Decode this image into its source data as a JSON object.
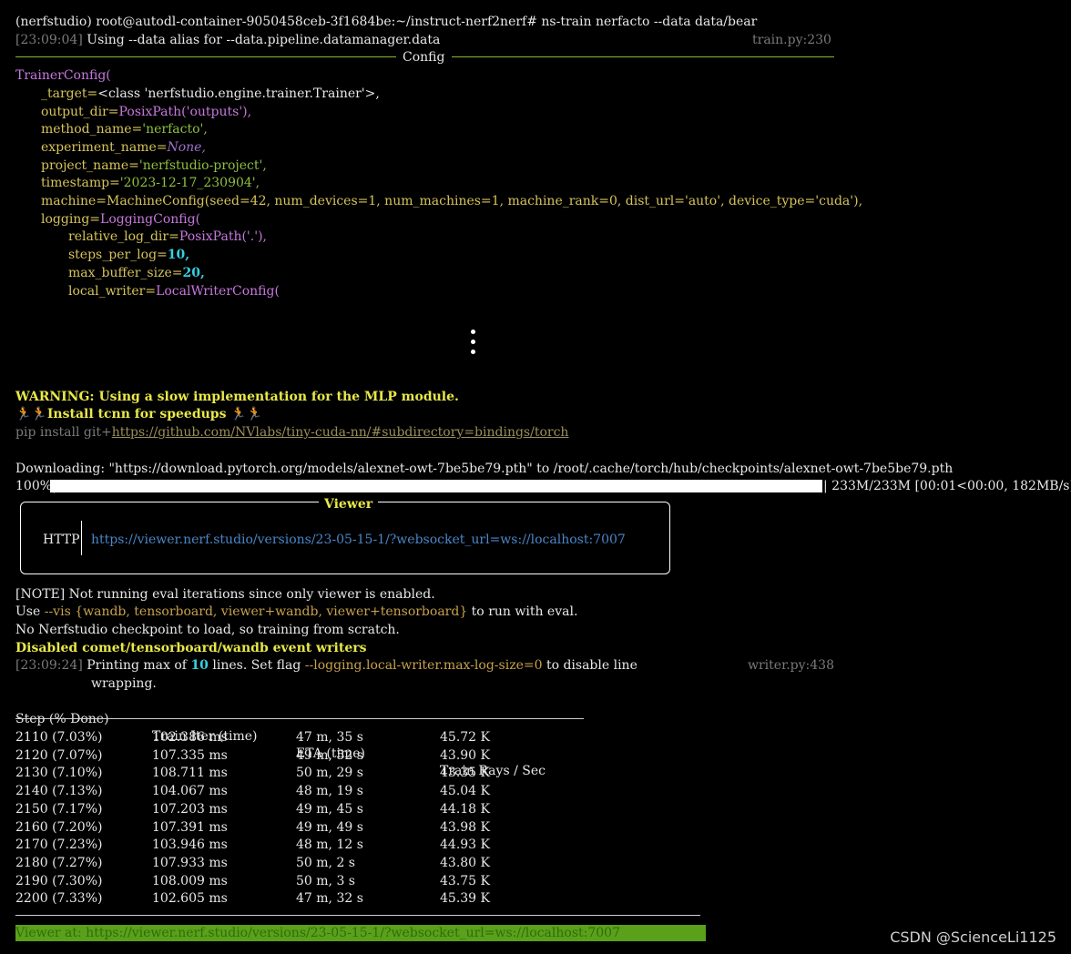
{
  "prompt": "(nerfstudio) root@autodl-container-9050458ceb-3f1684be:~/instruct-nerf2nerf# ns-train nerfacto --data data/bear",
  "log1": {
    "time": "[23:09:04]",
    "text": "Using --data alias for --data.pipeline.datamanager.data",
    "src": "train.py:230"
  },
  "config_title": "Config",
  "config": {
    "l1": "TrainerConfig(",
    "target_k": "_target=",
    "target_v": "<class 'nerfstudio.engine.trainer.Trainer'>,",
    "outdir_k": "output_dir=",
    "outdir_v": "PosixPath('outputs'),",
    "method_k": "method_name=",
    "method_v": "'nerfacto',",
    "exp_k": "experiment_name=",
    "exp_v": "None,",
    "proj_k": "project_name=",
    "proj_v": "'nerfstudio-project',",
    "ts_k": "timestamp=",
    "ts_v": "'2023-12-17_230904',",
    "machine": "machine=MachineConfig(seed=42, num_devices=1, num_machines=1, machine_rank=0, dist_url='auto', device_type='cuda'),",
    "logging_k": "logging=",
    "logging_v": "LoggingConfig(",
    "rel_k": "relative_log_dir=",
    "rel_v": "PosixPath('.'),",
    "steps_k": "steps_per_log=",
    "steps_v": "10,",
    "buf_k": "max_buffer_size=",
    "buf_v": "20,",
    "lw_k": "local_writer=",
    "lw_v": "LocalWriterConfig("
  },
  "warning": {
    "l1": "WARNING: Using a slow implementation for the MLP module.",
    "l2": "🏃🏃Install tcnn for speedups 🏃🏃",
    "l3a": "pip install git+",
    "l3b": "https://github.com/NVlabs/tiny-cuda-nn/#subdirectory=bindings/torch"
  },
  "download": {
    "line": "Downloading: \"https://download.pytorch.org/models/alexnet-owt-7be5be79.pth\" to /root/.cache/torch/hub/checkpoints/alexnet-owt-7be5be79.pth",
    "percent": "100%|",
    "progress": 1.0,
    "stats": "| 233M/233M [00:01<00:00, 182MB/s]"
  },
  "viewer": {
    "title": "Viewer",
    "proto": "HTTP",
    "url": "https://viewer.nerf.studio/versions/23-05-15-1/?websocket_url=ws://localhost:7007"
  },
  "notes": {
    "n1": "[NOTE] Not running eval iterations since only viewer is enabled.",
    "n2a": "Use ",
    "n2b": "--vis {wandb, tensorboard, viewer+wandb, viewer+tensorboard}",
    "n2c": " to run with eval.",
    "n3": "No Nerfstudio checkpoint to load, so training from scratch.",
    "n4": "Disabled comet/tensorboard/wandb event writers"
  },
  "log2": {
    "time": "[23:09:24]",
    "t1": "Printing max of ",
    "t2": "10",
    "t3": " lines. Set flag ",
    "t4": "--logging.local-writer.max-log-size=0",
    "t5": " to disable line",
    "t6": "wrapping.",
    "src": "writer.py:438"
  },
  "table": {
    "headers": [
      "Step (% Done)",
      "Train Iter (time)",
      "ETA (time)",
      "Train Rays / Sec"
    ],
    "rows": [
      [
        "2110 (7.03%)",
        "102.386 ms",
        "47 m, 35 s",
        "45.72 K"
      ],
      [
        "2120 (7.07%)",
        "107.335 ms",
        "49 m, 52 s",
        "43.90 K"
      ],
      [
        "2130 (7.10%)",
        "108.711 ms",
        "50 m, 29 s",
        "43.35 K"
      ],
      [
        "2140 (7.13%)",
        "104.067 ms",
        "48 m, 19 s",
        "45.04 K"
      ],
      [
        "2150 (7.17%)",
        "107.203 ms",
        "49 m, 45 s",
        "44.18 K"
      ],
      [
        "2160 (7.20%)",
        "107.391 ms",
        "49 m, 49 s",
        "43.98 K"
      ],
      [
        "2170 (7.23%)",
        "103.946 ms",
        "48 m, 12 s",
        "44.93 K"
      ],
      [
        "2180 (7.27%)",
        "107.933 ms",
        "50 m, 2 s",
        "43.80 K"
      ],
      [
        "2190 (7.30%)",
        "108.009 ms",
        "50 m, 3 s",
        "43.75 K"
      ],
      [
        "2200 (7.33%)",
        "102.605 ms",
        "47 m, 32 s",
        "45.39 K"
      ]
    ]
  },
  "footer": "Viewer at: https://viewer.nerf.studio/versions/23-05-15-1/?websocket_url=ws://localhost:7007",
  "watermark": "CSDN @ScienceLi1125"
}
